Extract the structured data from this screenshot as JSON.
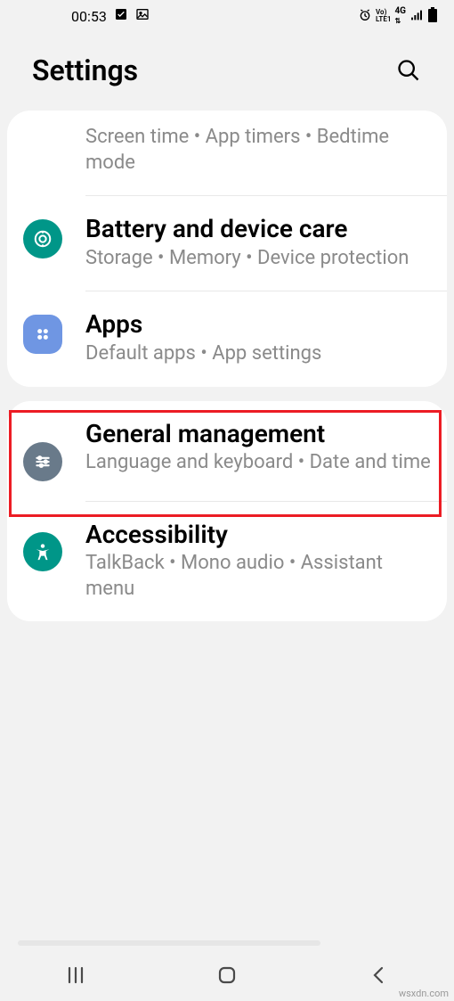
{
  "statusbar": {
    "time": "00:53",
    "indicators": [
      "alarm",
      "VoLTE1",
      "4G",
      "signal",
      "battery"
    ]
  },
  "header": {
    "title": "Settings"
  },
  "card1": {
    "screentime": {
      "sub": "Screen time  •  App timers  •  Bedtime mode"
    },
    "battery": {
      "title": "Battery and device care",
      "sub": "Storage  •  Memory  •  Device protection"
    },
    "apps": {
      "title": "Apps",
      "sub": "Default apps  •  App settings"
    }
  },
  "card2": {
    "general": {
      "title": "General management",
      "sub": "Language and keyboard  •  Date and time"
    },
    "accessibility": {
      "title": "Accessibility",
      "sub": "TalkBack  •  Mono audio  •  Assistant menu"
    }
  },
  "watermark": "wsxdn.com"
}
